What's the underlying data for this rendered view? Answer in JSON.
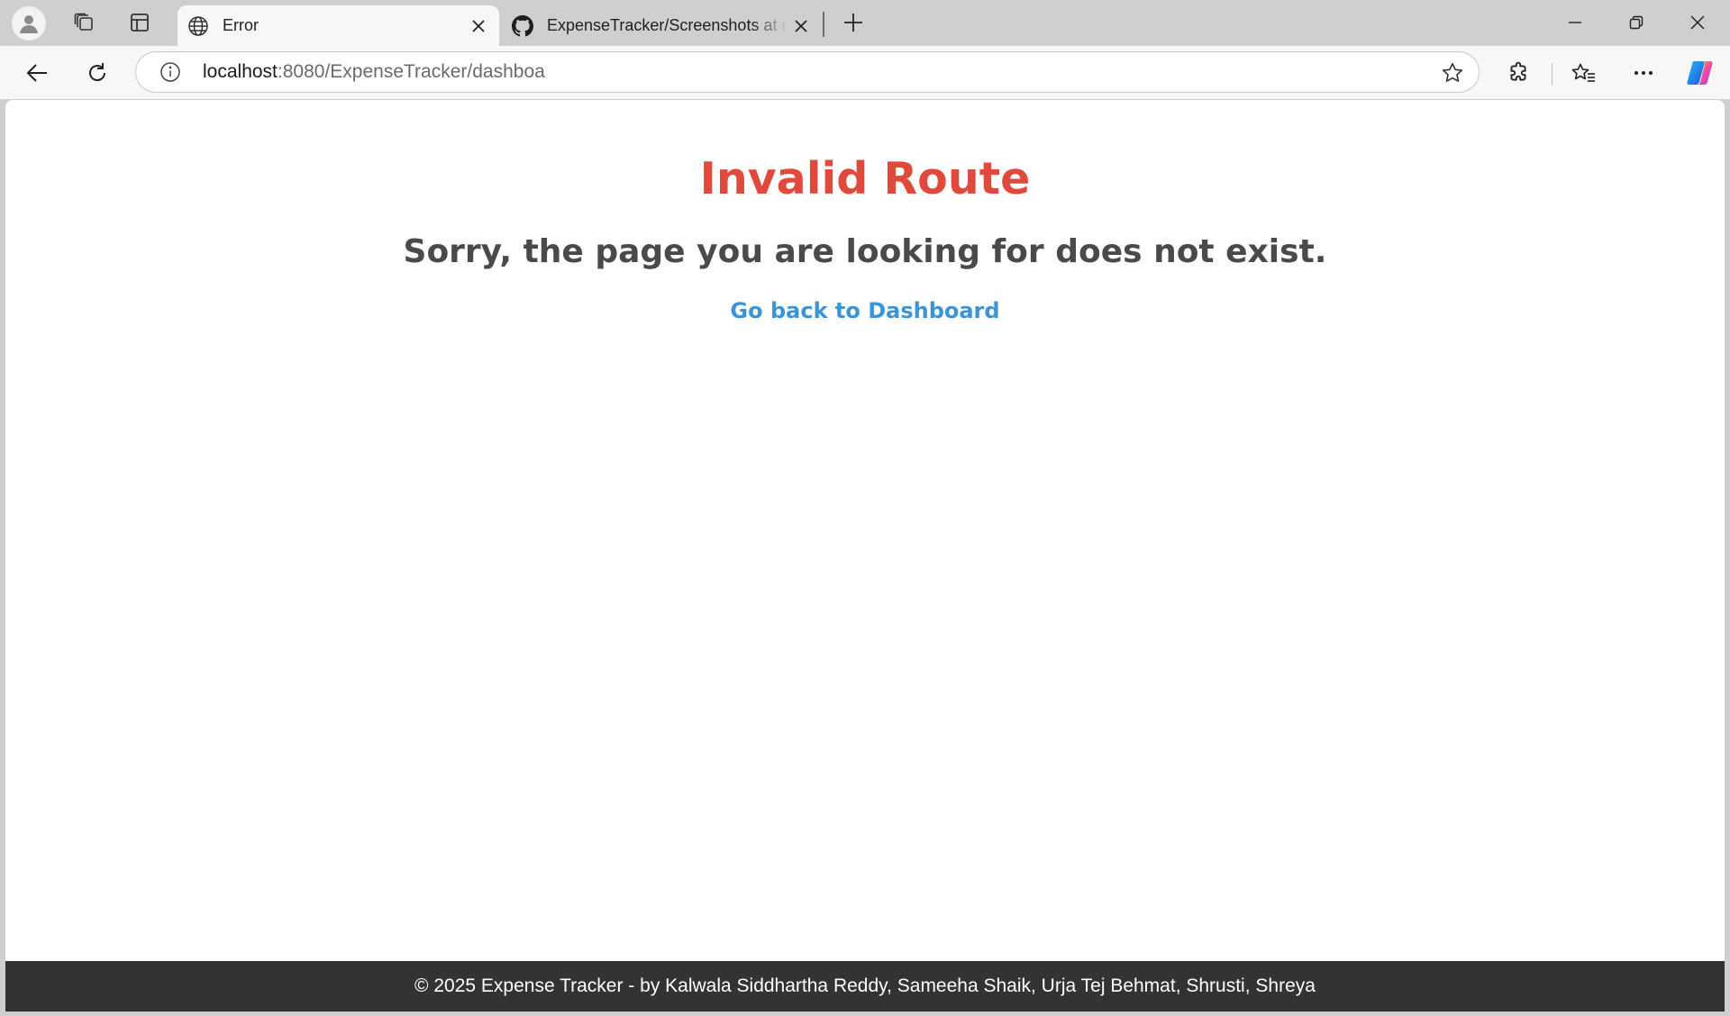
{
  "browser": {
    "tabs": [
      {
        "title": "Error",
        "active": true,
        "icon": "globe-icon"
      },
      {
        "title": "ExpenseTracker/Screenshots at main",
        "active": false,
        "icon": "github-icon"
      }
    ],
    "address": {
      "host": "localhost",
      "rest": ":8080/ExpenseTracker/dashboa"
    },
    "icons": {
      "profile": "profile-icon",
      "workspaces": "workspaces-icon",
      "vertical_tabs": "vertical-tabs-icon",
      "new_tab": "plus-icon",
      "minimize": "minimize-icon",
      "restore": "restore-icon",
      "close": "close-icon",
      "back": "back-arrow-icon",
      "refresh": "refresh-icon",
      "info": "info-icon",
      "favorite": "star-icon",
      "extensions": "puzzle-icon",
      "favorites": "favorites-icon",
      "more": "more-icon",
      "copilot": "copilot-icon"
    }
  },
  "page": {
    "title": "Invalid Route",
    "subtitle": "Sorry, the page you are looking for does not exist.",
    "link": "Go back to Dashboard",
    "footer": "© 2025 Expense Tracker - by Kalwala Siddhartha Reddy, Sameeha Shaik, Urja Tej Behmat, Shrusti, Shreya"
  },
  "colors": {
    "title": "#e04a3c",
    "subtitle": "#4a4a4a",
    "link": "#3a94d6",
    "footer_bg": "#333333"
  }
}
